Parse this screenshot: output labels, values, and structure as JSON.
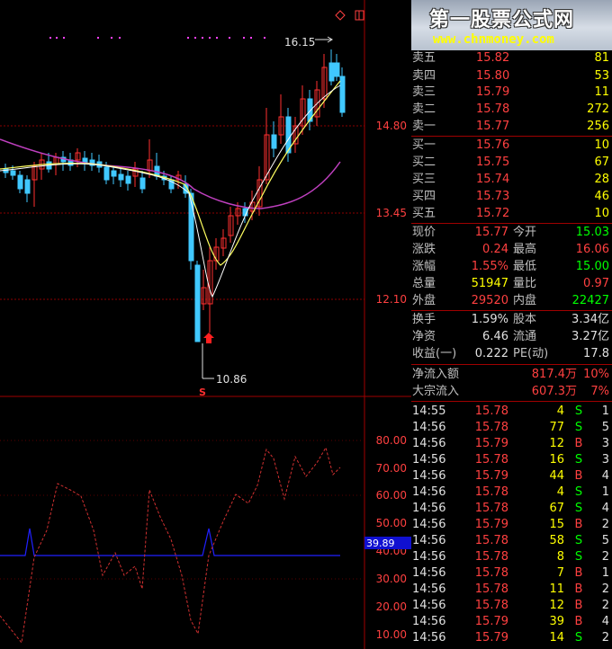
{
  "banner": {
    "title": "第一股票公式网",
    "url": "www.chnmoney.com"
  },
  "chart": {
    "high_label": "16.15",
    "low_label": "10.86",
    "y_ticks": [
      "14.80",
      "13.45",
      "12.10"
    ],
    "signal_label": "S",
    "indicator_ticks": [
      "80.00",
      "70.00",
      "60.00",
      "50.00",
      "40.00",
      "30.00",
      "20.00",
      "10.00"
    ],
    "indicator_value": "39.89",
    "colors": {
      "up": "#ff3030",
      "down": "#40c8ff",
      "ma_white": "#ffffff",
      "ma_yellow": "#ffff60",
      "ma_magenta": "#c040c0",
      "grid": "#8b0000",
      "indicator": "#d03030",
      "baseline": "#2020ff"
    }
  },
  "asks": [
    {
      "label": "卖五",
      "price": "15.82",
      "vol": "81"
    },
    {
      "label": "卖四",
      "price": "15.80",
      "vol": "53"
    },
    {
      "label": "卖三",
      "price": "15.79",
      "vol": "11"
    },
    {
      "label": "卖二",
      "price": "15.78",
      "vol": "272"
    },
    {
      "label": "卖一",
      "price": "15.77",
      "vol": "256"
    }
  ],
  "bids": [
    {
      "label": "买一",
      "price": "15.76",
      "vol": "10"
    },
    {
      "label": "买二",
      "price": "15.75",
      "vol": "67"
    },
    {
      "label": "买三",
      "price": "15.74",
      "vol": "28"
    },
    {
      "label": "买四",
      "price": "15.73",
      "vol": "46"
    },
    {
      "label": "买五",
      "price": "15.72",
      "vol": "10"
    }
  ],
  "quote": [
    {
      "l1": "现价",
      "v1": "15.77",
      "c1": "red",
      "l2": "今开",
      "v2": "15.03",
      "c2": "green"
    },
    {
      "l1": "涨跌",
      "v1": "0.24",
      "c1": "red",
      "l2": "最高",
      "v2": "16.06",
      "c2": "red"
    },
    {
      "l1": "涨幅",
      "v1": "1.55%",
      "c1": "red",
      "l2": "最低",
      "v2": "15.00",
      "c2": "green"
    },
    {
      "l1": "总量",
      "v1": "51947",
      "c1": "yellow",
      "l2": "量比",
      "v2": "0.97",
      "c2": "red"
    },
    {
      "l1": "外盘",
      "v1": "29520",
      "c1": "red",
      "l2": "内盘",
      "v2": "22427",
      "c2": "green"
    }
  ],
  "fundamentals": [
    {
      "l1": "换手",
      "v1": "1.59%",
      "l2": "股本",
      "v2": "3.34亿"
    },
    {
      "l1": "净资",
      "v1": "6.46",
      "l2": "流通",
      "v2": "3.27亿"
    },
    {
      "l1": "收益(一)",
      "v1": "0.222",
      "l2": "PE(动)",
      "v2": "17.8"
    }
  ],
  "flows": [
    {
      "label": "净流入额",
      "value": "817.4万",
      "pct": "10%"
    },
    {
      "label": "大宗流入",
      "value": "607.3万",
      "pct": "7%"
    }
  ],
  "ticks": [
    {
      "time": "14:55",
      "price": "15.78",
      "vol": "4",
      "dir": "S",
      "n": "1"
    },
    {
      "time": "14:56",
      "price": "15.78",
      "vol": "77",
      "dir": "S",
      "n": "5"
    },
    {
      "time": "14:56",
      "price": "15.79",
      "vol": "12",
      "dir": "B",
      "n": "3"
    },
    {
      "time": "14:56",
      "price": "15.78",
      "vol": "16",
      "dir": "S",
      "n": "3"
    },
    {
      "time": "14:56",
      "price": "15.79",
      "vol": "44",
      "dir": "B",
      "n": "4"
    },
    {
      "time": "14:56",
      "price": "15.78",
      "vol": "4",
      "dir": "S",
      "n": "1"
    },
    {
      "time": "14:56",
      "price": "15.78",
      "vol": "67",
      "dir": "S",
      "n": "4"
    },
    {
      "time": "14:56",
      "price": "15.79",
      "vol": "15",
      "dir": "B",
      "n": "2"
    },
    {
      "time": "14:56",
      "price": "15.78",
      "vol": "58",
      "dir": "S",
      "n": "5"
    },
    {
      "time": "14:56",
      "price": "15.78",
      "vol": "8",
      "dir": "S",
      "n": "2"
    },
    {
      "time": "14:56",
      "price": "15.78",
      "vol": "7",
      "dir": "B",
      "n": "1"
    },
    {
      "time": "14:56",
      "price": "15.78",
      "vol": "11",
      "dir": "B",
      "n": "2"
    },
    {
      "time": "14:56",
      "price": "15.78",
      "vol": "12",
      "dir": "B",
      "n": "2"
    },
    {
      "time": "14:56",
      "price": "15.79",
      "vol": "39",
      "dir": "B",
      "n": "4"
    },
    {
      "time": "14:56",
      "price": "15.79",
      "vol": "14",
      "dir": "S",
      "n": "2"
    }
  ]
}
